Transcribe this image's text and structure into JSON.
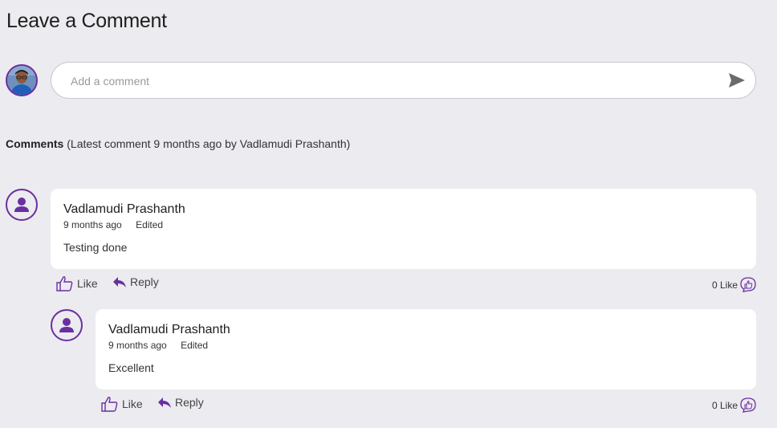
{
  "heading": "Leave a Comment",
  "composer": {
    "placeholder": "Add a comment",
    "send_icon": "send-icon"
  },
  "summary": {
    "label": "Comments",
    "detail": "(Latest comment 9 months ago by Vadlamudi Prashanth)"
  },
  "comments": [
    {
      "author": "Vadlamudi Prashanth",
      "time": "9 months ago",
      "edited": "Edited",
      "text": "Testing done",
      "like_label": "Like",
      "reply_label": "Reply",
      "like_count": "0 Like"
    },
    {
      "author": "Vadlamudi Prashanth",
      "time": "9 months ago",
      "edited": "Edited",
      "text": "Excellent",
      "like_label": "Like",
      "reply_label": "Reply",
      "like_count": "0 Like"
    }
  ],
  "colors": {
    "accent": "#6a2fa0",
    "background": "#ecebef",
    "card": "#ffffff"
  }
}
